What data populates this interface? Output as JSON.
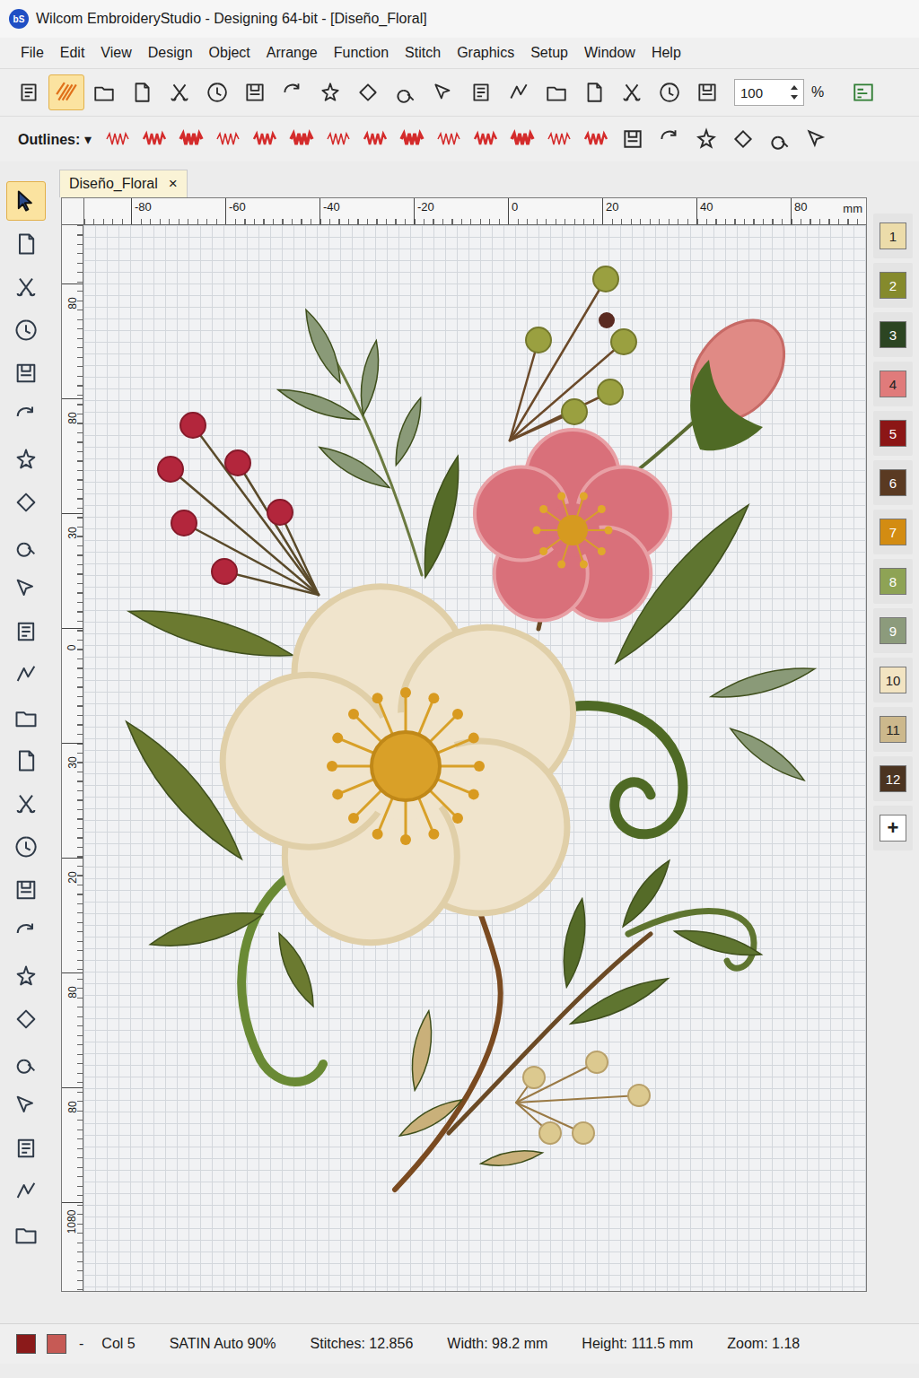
{
  "window": {
    "title": "Wilcom EmbroideryStudio - Designing 64-bit - [Diseño_Floral]",
    "logo": "bS"
  },
  "menu": [
    "File",
    "Edit",
    "View",
    "Design",
    "Object",
    "Arrange",
    "Function",
    "Stitch",
    "Graphics",
    "Setup",
    "Window",
    "Help"
  ],
  "toolbar": {
    "buttons": [
      {
        "selected": false
      },
      {
        "selected": true
      },
      {
        "selected": false
      },
      {
        "selected": false
      },
      {
        "selected": false
      },
      {
        "selected": false
      },
      {
        "selected": false
      },
      {
        "selected": false
      },
      {
        "selected": false
      },
      {
        "selected": false
      },
      {
        "selected": false
      },
      {
        "selected": false
      },
      {
        "selected": false
      },
      {
        "selected": false
      },
      {
        "selected": false
      },
      {
        "selected": false
      },
      {
        "selected": false
      },
      {
        "selected": false
      },
      {
        "selected": false
      }
    ],
    "zoom": {
      "value": "100",
      "unit": "%"
    },
    "end_buttons": [
      {
        "selected": false
      }
    ]
  },
  "stitch_toolbar": {
    "label": "Outlines:",
    "dropdown": "▾",
    "buttons": [
      {
        "kind": "stitch"
      },
      {
        "kind": "stitch"
      },
      {
        "kind": "stitch"
      },
      {
        "kind": "stitch"
      },
      {
        "kind": "stitch"
      },
      {
        "kind": "stitch"
      },
      {
        "kind": "stitch"
      },
      {
        "kind": "stitch"
      },
      {
        "kind": "stitch"
      },
      {
        "kind": "stitch"
      },
      {
        "kind": "stitch"
      },
      {
        "kind": "stitch"
      },
      {
        "kind": "stitch"
      },
      {
        "kind": "stitch"
      },
      {
        "kind": "tool"
      },
      {
        "kind": "tool"
      },
      {
        "kind": "tool"
      },
      {
        "kind": "tool"
      },
      {
        "kind": "tool"
      },
      {
        "kind": "tool"
      }
    ]
  },
  "tools": [
    {
      "selected": true
    },
    {
      "selected": false
    },
    {
      "selected": false
    },
    {
      "selected": false
    },
    {
      "selected": false
    },
    {
      "selected": false
    },
    {
      "selected": false
    },
    {
      "selected": false
    },
    {
      "selected": false
    },
    {
      "selected": false
    },
    {
      "selected": false
    },
    {
      "selected": false
    },
    {
      "selected": false
    },
    {
      "selected": false
    },
    {
      "selected": false
    },
    {
      "selected": false
    },
    {
      "selected": false
    },
    {
      "selected": false
    },
    {
      "selected": false
    },
    {
      "selected": false
    },
    {
      "selected": false
    },
    {
      "selected": false
    },
    {
      "selected": false
    },
    {
      "selected": false
    },
    {
      "selected": false
    }
  ],
  "document_tab": {
    "label": "Diseño_Floral",
    "close": "×",
    "selected": true
  },
  "ruler": {
    "top": [
      "-80",
      "-60",
      "-40",
      "-20",
      "0",
      "20",
      "40",
      "80"
    ],
    "unit": "mm",
    "left": [
      "80",
      "80",
      "30",
      "0",
      "30",
      "20",
      "80",
      "80",
      "1080"
    ]
  },
  "palette": {
    "colors": [
      {
        "label": "1",
        "color": "#ecdcaa"
      },
      {
        "label": "2",
        "color": "#858a2c"
      },
      {
        "label": "3",
        "color": "#2c4522"
      },
      {
        "label": "4",
        "color": "#e07b7b"
      },
      {
        "label": "5",
        "color": "#8c1616"
      },
      {
        "label": "6",
        "color": "#5a3a22"
      },
      {
        "label": "7",
        "color": "#d38c12"
      },
      {
        "label": "8",
        "color": "#8ea355"
      },
      {
        "label": "9",
        "color": "#8c9b7c"
      },
      {
        "label": "10",
        "color": "#f2e4c2"
      },
      {
        "label": "11",
        "color": "#ccb88c"
      },
      {
        "label": "12",
        "color": "#4b3421"
      }
    ],
    "add": "+"
  },
  "status_bar": {
    "swatches": [
      {
        "color": "#8b1a1a"
      },
      {
        "color": "#c65a55"
      }
    ],
    "separator": "-",
    "items": [
      "Col 5",
      "SATIN Auto 90%",
      "Stitches: 12.856",
      "Width: 98.2 mm",
      "Height: 111.5 mm",
      "Zoom: 1.18"
    ]
  }
}
